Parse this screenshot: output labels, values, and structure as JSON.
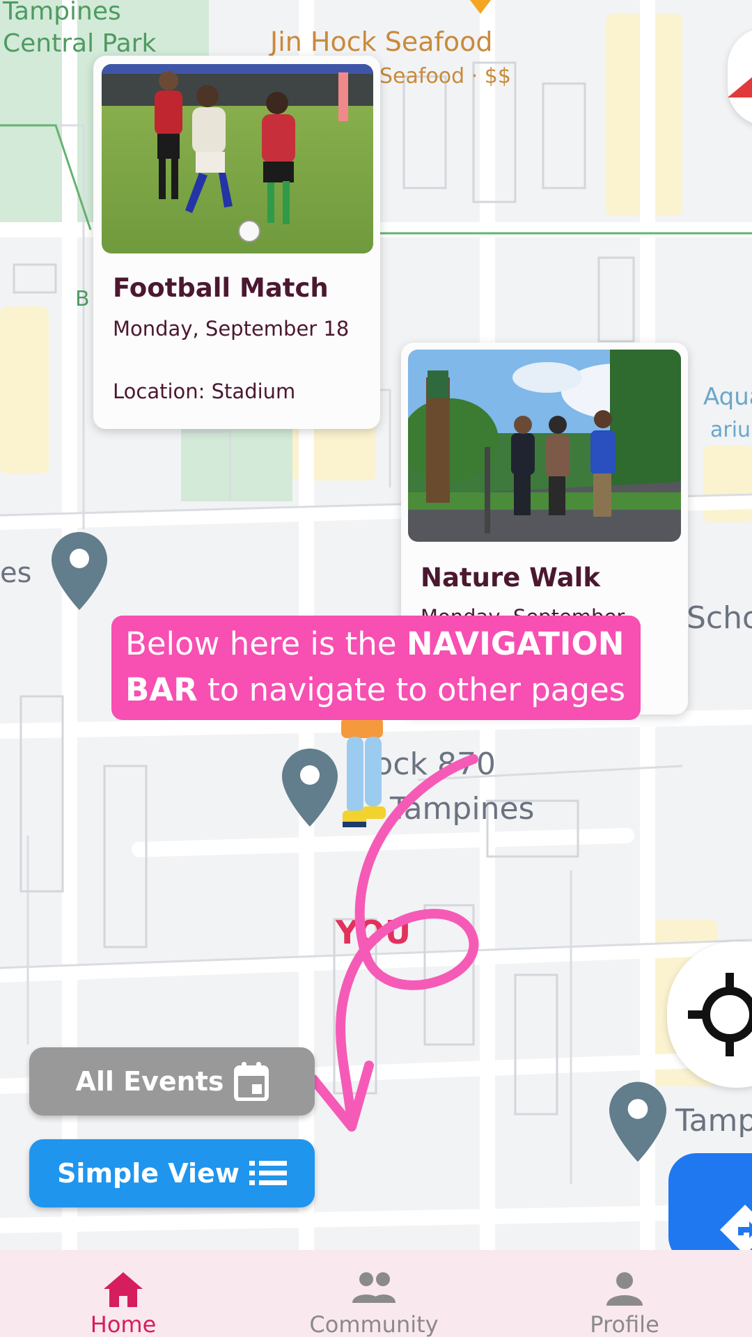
{
  "map": {
    "labels": {
      "park": "Tampines\nCentral Park",
      "restaurant_name": "Jin Hock Seafood",
      "restaurant_sub": "Seafood · $$",
      "block_line1": "Block 870",
      "block_line2": "Tampines",
      "edge_left": "es",
      "edge_school": "Scho",
      "edge_tamp": "Tamp",
      "edge_aqua1": "Aqua",
      "edge_aqua2": "arium",
      "edge_b": "B",
      "you": "YOU"
    }
  },
  "events": [
    {
      "title": "Football Match",
      "date": "Monday, September 18",
      "location": "Location: Stadium"
    },
    {
      "title": "Nature Walk",
      "date": "Monday, September"
    }
  ],
  "tutorial": {
    "part1": "Below here is the ",
    "bold1": "NAVIGATION",
    "bold2": "BAR",
    "part2": " to navigate to other pages"
  },
  "buttons": {
    "all_events": "All Events",
    "simple_view": "Simple View"
  },
  "nav": {
    "items": [
      {
        "label": "Home",
        "icon": "home-icon"
      },
      {
        "label": "Community",
        "icon": "community-icon"
      },
      {
        "label": "Profile",
        "icon": "profile-icon"
      }
    ],
    "active_color": "#d61d5e",
    "inactive_color": "#8a8a8a"
  },
  "colors": {
    "tutorial_bg": "#f74fb2",
    "all_events_bg": "#999999",
    "simple_view_bg": "#1f95ee",
    "nav_bg": "#fae8ef"
  }
}
